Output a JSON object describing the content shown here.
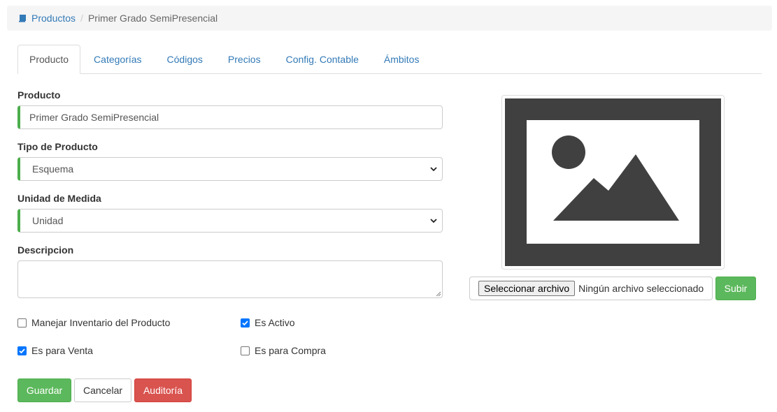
{
  "colors": {
    "accent": "#337ab7",
    "success": "#5cb85c",
    "danger": "#d9534f",
    "checkbox": "#0075ff"
  },
  "breadcrumb": {
    "icon": "book-icon",
    "parent": "Productos",
    "separator": "/",
    "current": "Primer Grado SemiPresencial"
  },
  "tabs": [
    {
      "label": "Producto",
      "active": true
    },
    {
      "label": "Categorías"
    },
    {
      "label": "Códigos"
    },
    {
      "label": "Precios"
    },
    {
      "label": "Config. Contable"
    },
    {
      "label": "Ámbitos"
    }
  ],
  "form": {
    "producto": {
      "label": "Producto",
      "value": "Primer Grado SemiPresencial"
    },
    "tipo": {
      "label": "Tipo de Producto",
      "value": "Esquema"
    },
    "unidad": {
      "label": "Unidad de Medida",
      "value": "Unidad"
    },
    "descripcion": {
      "label": "Descripcion",
      "value": ""
    },
    "checks": {
      "inventario": {
        "label": "Manejar Inventario del Producto",
        "checked": false
      },
      "activo": {
        "label": "Es Activo",
        "checked": true
      },
      "venta": {
        "label": "Es para Venta",
        "checked": true
      },
      "compra": {
        "label": "Es para Compra",
        "checked": false
      }
    }
  },
  "buttons": {
    "save": "Guardar",
    "cancel": "Cancelar",
    "audit": "Auditoría"
  },
  "image": {
    "icon": "image-placeholder-icon"
  },
  "upload": {
    "choose": "Seleccionar archivo",
    "status": "Ningún archivo seleccionado",
    "submit": "Subir"
  }
}
